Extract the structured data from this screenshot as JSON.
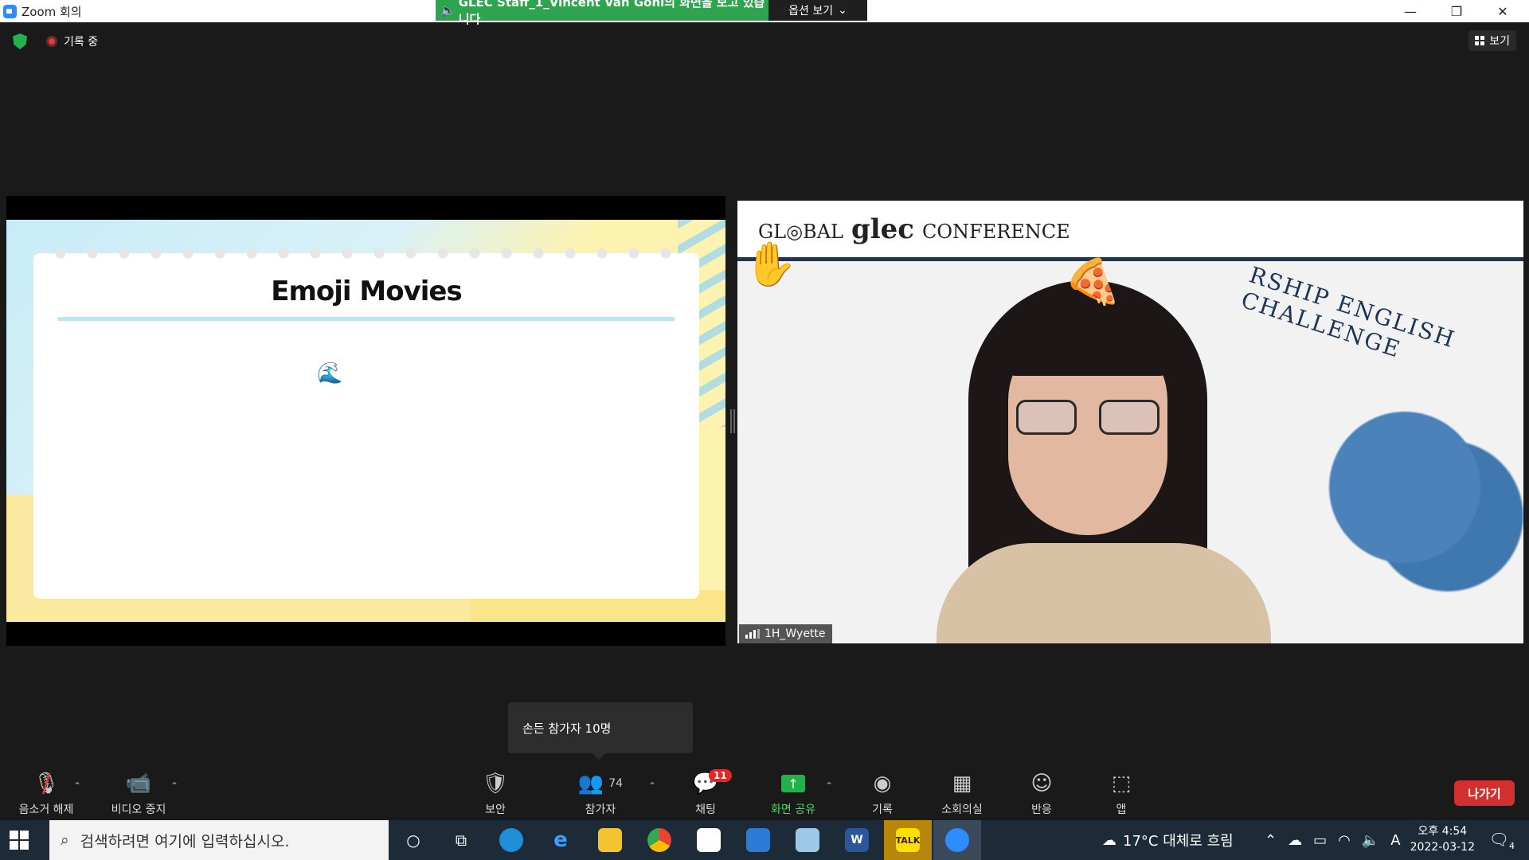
{
  "window": {
    "title": "Zoom 회의",
    "minimize": "—",
    "maximize": "❐",
    "close": "✕"
  },
  "share_banner": {
    "text": "GLEC Staff_1_Vincent Van Goni의 화면을 보고 있습니다",
    "options": "옵션 보기"
  },
  "status": {
    "recording": "기록 중"
  },
  "view_button": "보기",
  "shared_slide": {
    "title": "Emoji Movies",
    "emoji": "🌊"
  },
  "video": {
    "banner_prefix": "GL◎BAL",
    "banner_brand": "glec",
    "banner_suffix": "CONFERENCE",
    "arc_text": "RSHIP ENGLISH CHALLENGE",
    "participant_name": "1H_Wyette",
    "reaction_hand": "✋",
    "reaction_pizza": "🍕"
  },
  "tooltip": "손든 참가자 10명",
  "toolbar": {
    "mute": "음소거 해제",
    "video": "비디오 중지",
    "security": "보안",
    "participants": "참가자",
    "participants_count": "74",
    "chat": "채팅",
    "chat_badge": "11",
    "share": "화면 공유",
    "record": "기록",
    "breakout": "소회의실",
    "reactions": "반응",
    "apps": "앱",
    "leave": "나가기"
  },
  "taskbar": {
    "search_placeholder": "검색하려면 여기에 입력하십시오.",
    "weather": "17°C  대체로 흐림",
    "time": "오후 4:54",
    "date": "2022-03-12",
    "ime": "A",
    "notif_count": "4"
  },
  "colors": {
    "share_green": "#2ea44f",
    "leave_red": "#d32f2f",
    "badge_red": "#e02828",
    "accent_blue": "#2d8cff"
  }
}
